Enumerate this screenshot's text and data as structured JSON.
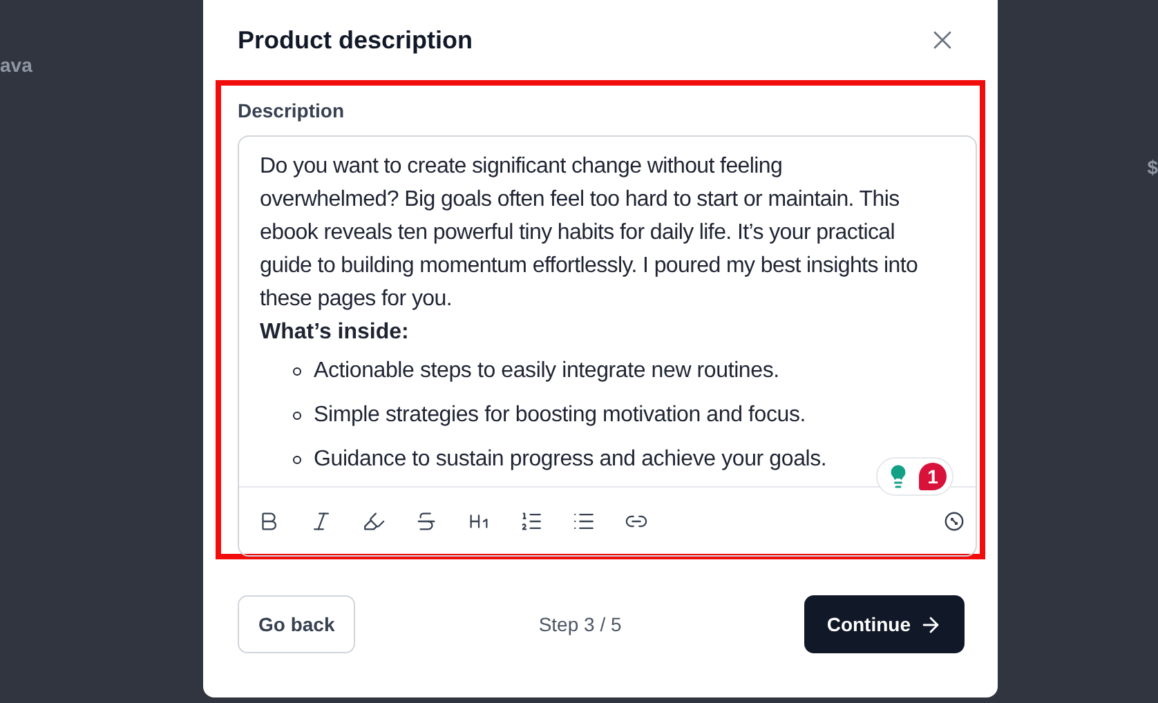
{
  "background": {
    "left_text": "ava",
    "right_text": "$"
  },
  "dialog": {
    "title": "Product description",
    "field": {
      "label": "Description",
      "paragraph": "Do you want to create significant change without feeling overwhelmed? Big goals often feel too hard to start or maintain. This ebook reveals ten powerful tiny habits for daily life. It’s your practical guide to building momentum effortlessly. I poured my best insights into these pages for you.",
      "heading": "What’s inside:",
      "bullets": [
        "Actionable steps to easily integrate new routines.",
        "Simple strategies for boosting motivation and focus.",
        "Guidance to sustain progress and achieve your goals."
      ],
      "suggestion_count": "1",
      "toolbar": [
        {
          "kind": "bold"
        },
        {
          "kind": "italic"
        },
        {
          "kind": "highlight"
        },
        {
          "kind": "strike"
        },
        {
          "kind": "heading"
        },
        {
          "kind": "ordered"
        },
        {
          "kind": "bullet"
        },
        {
          "kind": "link"
        }
      ]
    },
    "footer": {
      "back": "Go back",
      "step": "Step 3 / 5",
      "continue": "Continue"
    }
  }
}
